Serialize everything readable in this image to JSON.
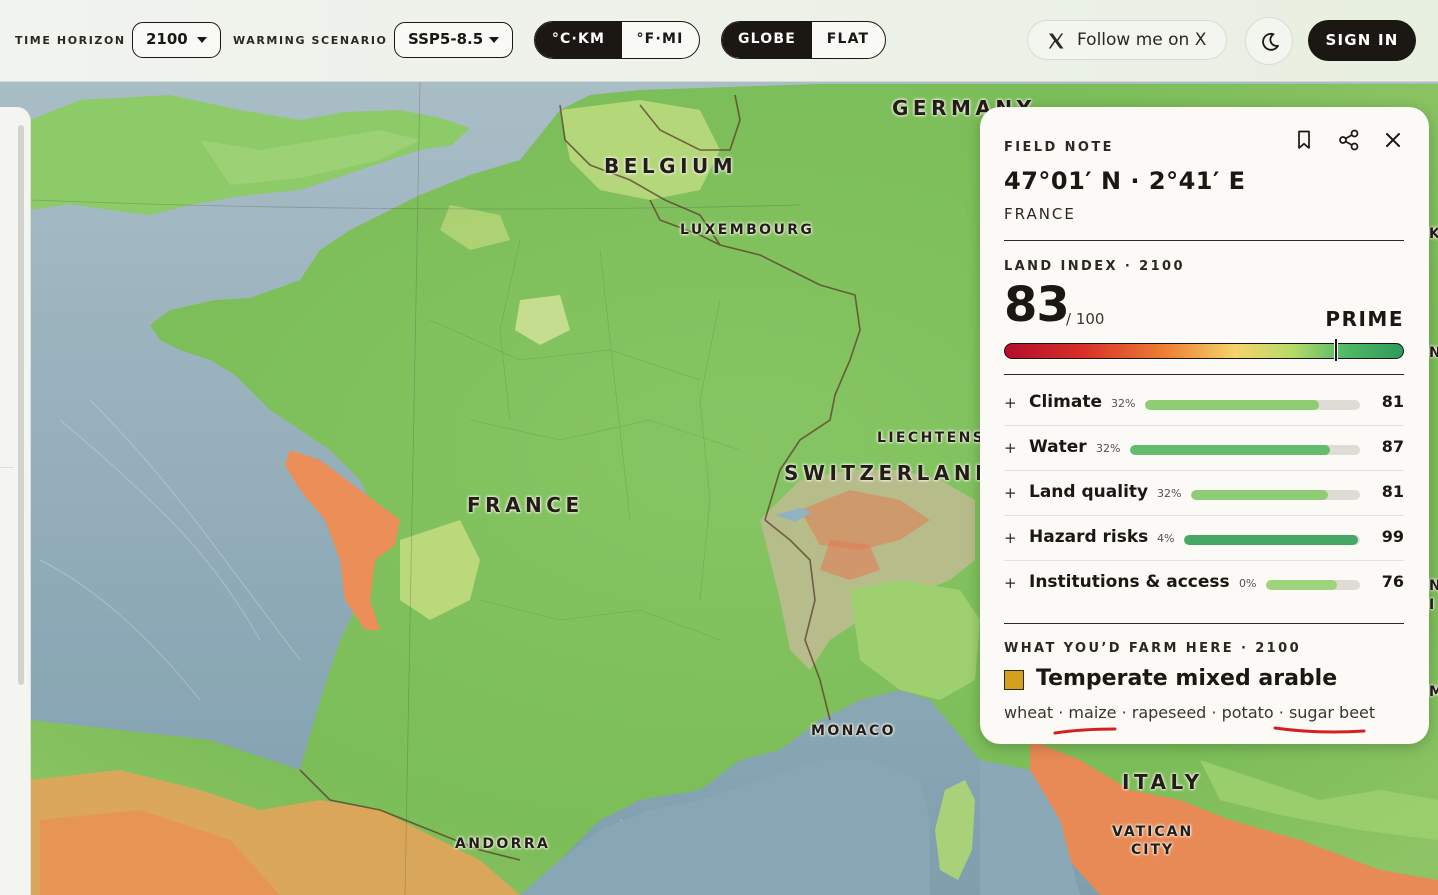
{
  "toolbar": {
    "time_horizon_label": "TIME HORIZON",
    "time_horizon_value": "2100",
    "scenario_label": "WARMING SCENARIO",
    "scenario_value": "SSP5-8.5",
    "units": [
      "°C·KM",
      "°F·MI"
    ],
    "units_selected": "°C·KM",
    "projection": [
      "GLOBE",
      "FLAT"
    ],
    "projection_selected": "GLOBE",
    "follow_label": "Follow me on X",
    "sign_in_label": "SIGN IN"
  },
  "map": {
    "countries": {
      "germany": "GERMANY",
      "belgium": "BELGIUM",
      "luxembourg": "LUXEMBOURG",
      "france": "FRANCE",
      "liechtenstein": "LIECHTENS",
      "switzerland": "SWITZERLAND",
      "monaco": "MONACO",
      "andorra": "ANDORRA",
      "italy": "ITALY",
      "vatican_line1": "VATICAN",
      "vatican_line2": "CITY"
    },
    "edge_letters": [
      "K",
      "N",
      "N",
      "I",
      "M"
    ]
  },
  "field_note": {
    "heading": "FIELD NOTE",
    "coordinates": "47°01′ N · 2°41′ E",
    "country": "FRANCE",
    "land_index_label": "LAND INDEX · 2100",
    "score": 83,
    "score_max": "/ 100",
    "score_fraction": 0.83,
    "grade": "PRIME",
    "factors": [
      {
        "name": "Climate",
        "weight": "32%",
        "value": 81,
        "fill": 0.81,
        "color": "#8fcd74"
      },
      {
        "name": "Water",
        "weight": "32%",
        "value": 87,
        "fill": 0.87,
        "color": "#63bd6c"
      },
      {
        "name": "Land quality",
        "weight": "32%",
        "value": 81,
        "fill": 0.81,
        "color": "#8fcd74"
      },
      {
        "name": "Hazard risks",
        "weight": "4%",
        "value": 99,
        "fill": 0.99,
        "color": "#45a965"
      },
      {
        "name": "Institutions & access",
        "weight": "0%",
        "value": 76,
        "fill": 0.76,
        "color": "#9fd47b"
      }
    ],
    "farm_label": "WHAT YOU’D FARM HERE · 2100",
    "farm_type": "Temperate mixed arable",
    "farm_color": "#d4a11f",
    "crops": [
      "wheat",
      "maize",
      "rapeseed",
      "potato",
      "sugar beet"
    ],
    "crop_separator": " · ",
    "underlined_crops": [
      "maize",
      "sugar beet"
    ]
  }
}
